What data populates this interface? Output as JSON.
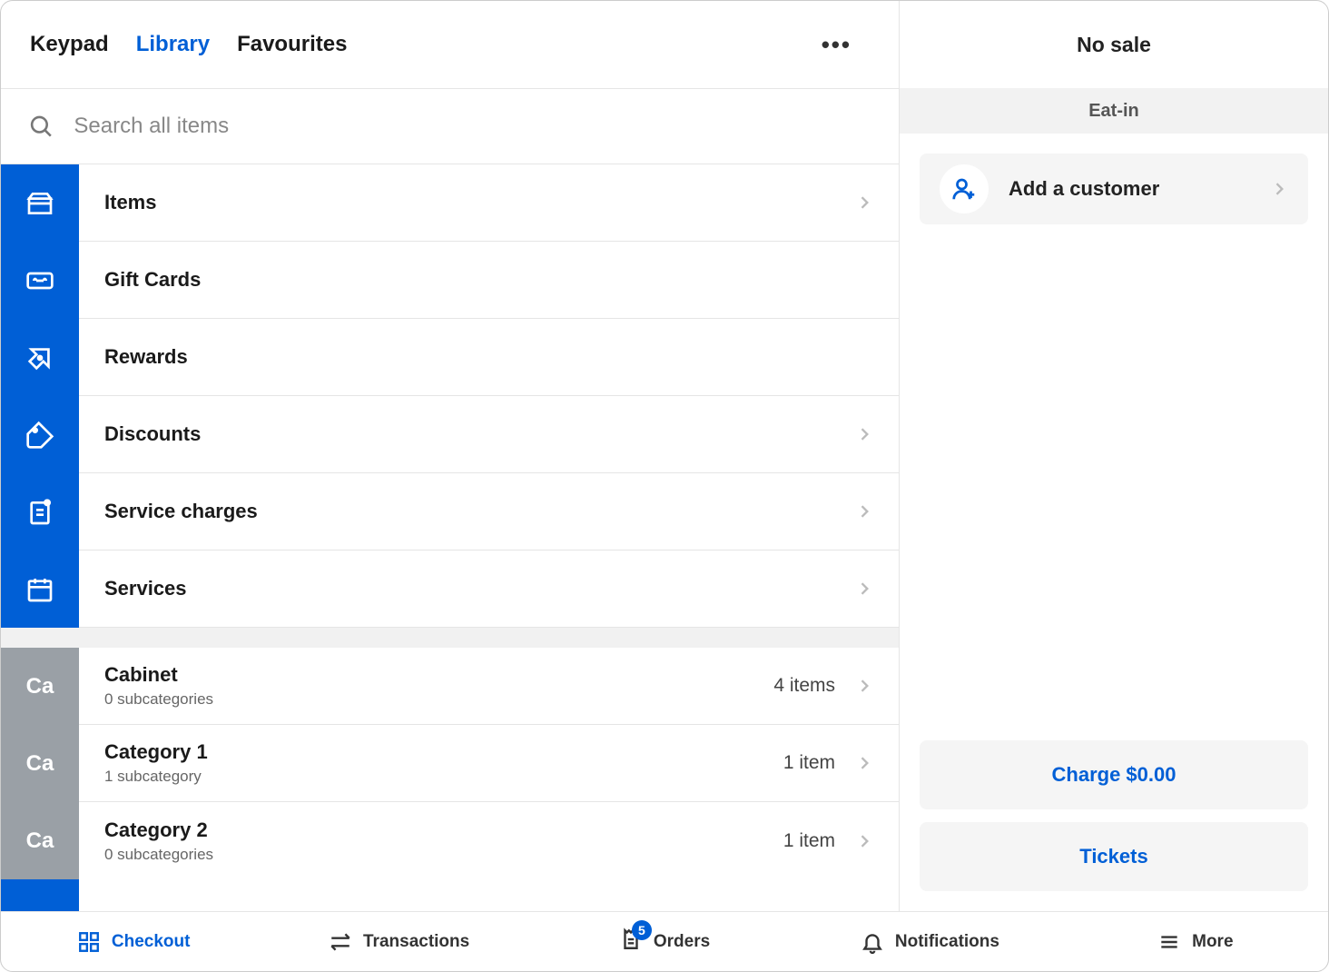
{
  "tabs": {
    "keypad": "Keypad",
    "library": "Library",
    "favourites": "Favourites"
  },
  "search": {
    "placeholder": "Search all items"
  },
  "library_sections": {
    "items": {
      "label": "Items"
    },
    "giftcards": {
      "label": "Gift Cards"
    },
    "rewards": {
      "label": "Rewards"
    },
    "discounts": {
      "label": "Discounts"
    },
    "service_charges": {
      "label": "Service charges"
    },
    "services": {
      "label": "Services"
    }
  },
  "categories": [
    {
      "abbr": "Ca",
      "name": "Cabinet",
      "sub": "0 subcategories",
      "count": "4 items"
    },
    {
      "abbr": "Ca",
      "name": "Category 1",
      "sub": "1 subcategory",
      "count": "1 item"
    },
    {
      "abbr": "Ca",
      "name": "Category 2",
      "sub": "0 subcategories",
      "count": "1 item"
    }
  ],
  "cart": {
    "title": "No sale",
    "dining": "Eat-in",
    "add_customer": "Add a customer",
    "charge": "Charge $0.00",
    "tickets": "Tickets"
  },
  "nav": {
    "checkout": "Checkout",
    "transactions": "Transactions",
    "orders": "Orders",
    "orders_badge": "5",
    "notifications": "Notifications",
    "more": "More"
  }
}
